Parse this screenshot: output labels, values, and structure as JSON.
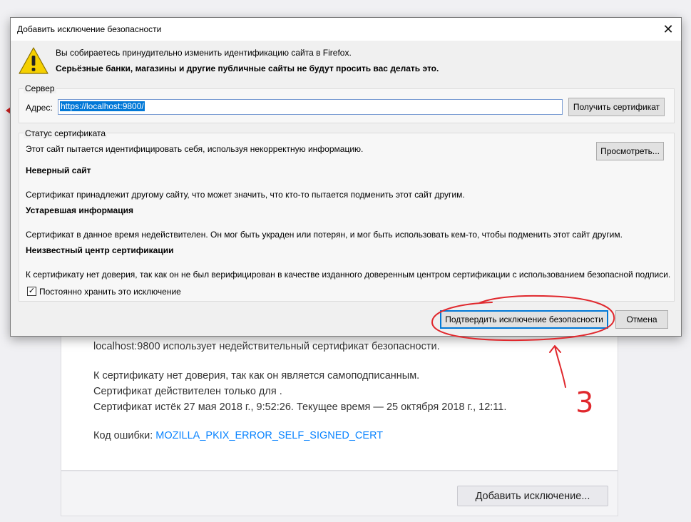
{
  "dialog": {
    "title": "Добавить исключение безопасности",
    "close_glyph": "✕",
    "warning_line1": "Вы собираетесь принудительно изменить идентификацию сайта в Firefox.",
    "warning_line2": "Серьёзные банки, магазины и другие публичные сайты не будут просить вас делать это.",
    "server": {
      "group_label": "Сервер",
      "address_label": "Адрес:",
      "address_value": "https://localhost:9800/",
      "get_cert_button": "Получить сертификат"
    },
    "status": {
      "group_label": "Статус сертификата",
      "intro": "Этот сайт пытается идентифицировать себя, используя некорректную информацию.",
      "view_button": "Просмотреть...",
      "issues": [
        {
          "heading": "Неверный сайт",
          "text": "Сертификат принадлежит другому сайту, что может значить, что кто-то пытается подменить этот сайт другим."
        },
        {
          "heading": "Устаревшая информация",
          "text": "Сертификат в данное время недействителен. Он мог быть украден или потерян, и мог быть использовать кем-то, чтобы подменить этот сайт другим."
        },
        {
          "heading": "Неизвестный центр сертификации",
          "text": "К сертификату нет доверия, так как он не был верифицирован в качестве изданного доверенным центром сертификации с использованием безопасной подписи."
        }
      ],
      "permanent_checkbox_label": "Постоянно хранить это исключение",
      "permanent_checked": true
    },
    "confirm_button": "Подтвердить исключение безопасности",
    "cancel_button": "Отмена"
  },
  "background_page": {
    "line1": "localhost:9800 использует недействительный сертификат безопасности.",
    "line2": "К сертификату нет доверия, так как он является самоподписанным.",
    "line3": "Сертификат действителен только для .",
    "line4": "Сертификат истёк 27 мая 2018 г., 9:52:26. Текущее время — 25 октября 2018 г., 12:11.",
    "error_code_label": "Код ошибки:",
    "error_code": "MOZILLA_PKIX_ERROR_SELF_SIGNED_CERT",
    "add_exception_button": "Добавить исключение..."
  },
  "annotation": {
    "number": "3",
    "color": "#e0282d"
  }
}
